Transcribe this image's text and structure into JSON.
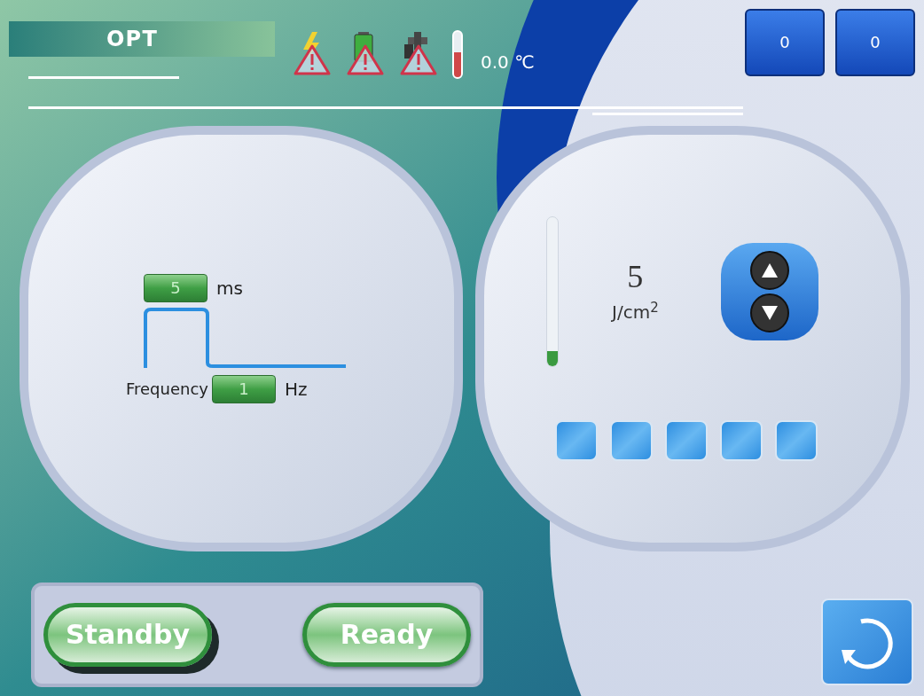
{
  "header": {
    "title": "OPT",
    "temperature": {
      "reading": "0.0 ℃",
      "level": 0.55
    },
    "counters": [
      "0",
      "0"
    ]
  },
  "pulse_panel": {
    "pulse_width": {
      "value": "5",
      "unit": "ms"
    },
    "frequency": {
      "label": "Frequency",
      "value": "1",
      "unit": "Hz"
    }
  },
  "energy_panel": {
    "value": "5",
    "unit": "J/cm$^{2}$",
    "level": 0.1
  },
  "mode_buttons": [
    {
      "label": "Standby",
      "selected": true
    },
    {
      "label": "Ready",
      "selected": false
    }
  ]
}
